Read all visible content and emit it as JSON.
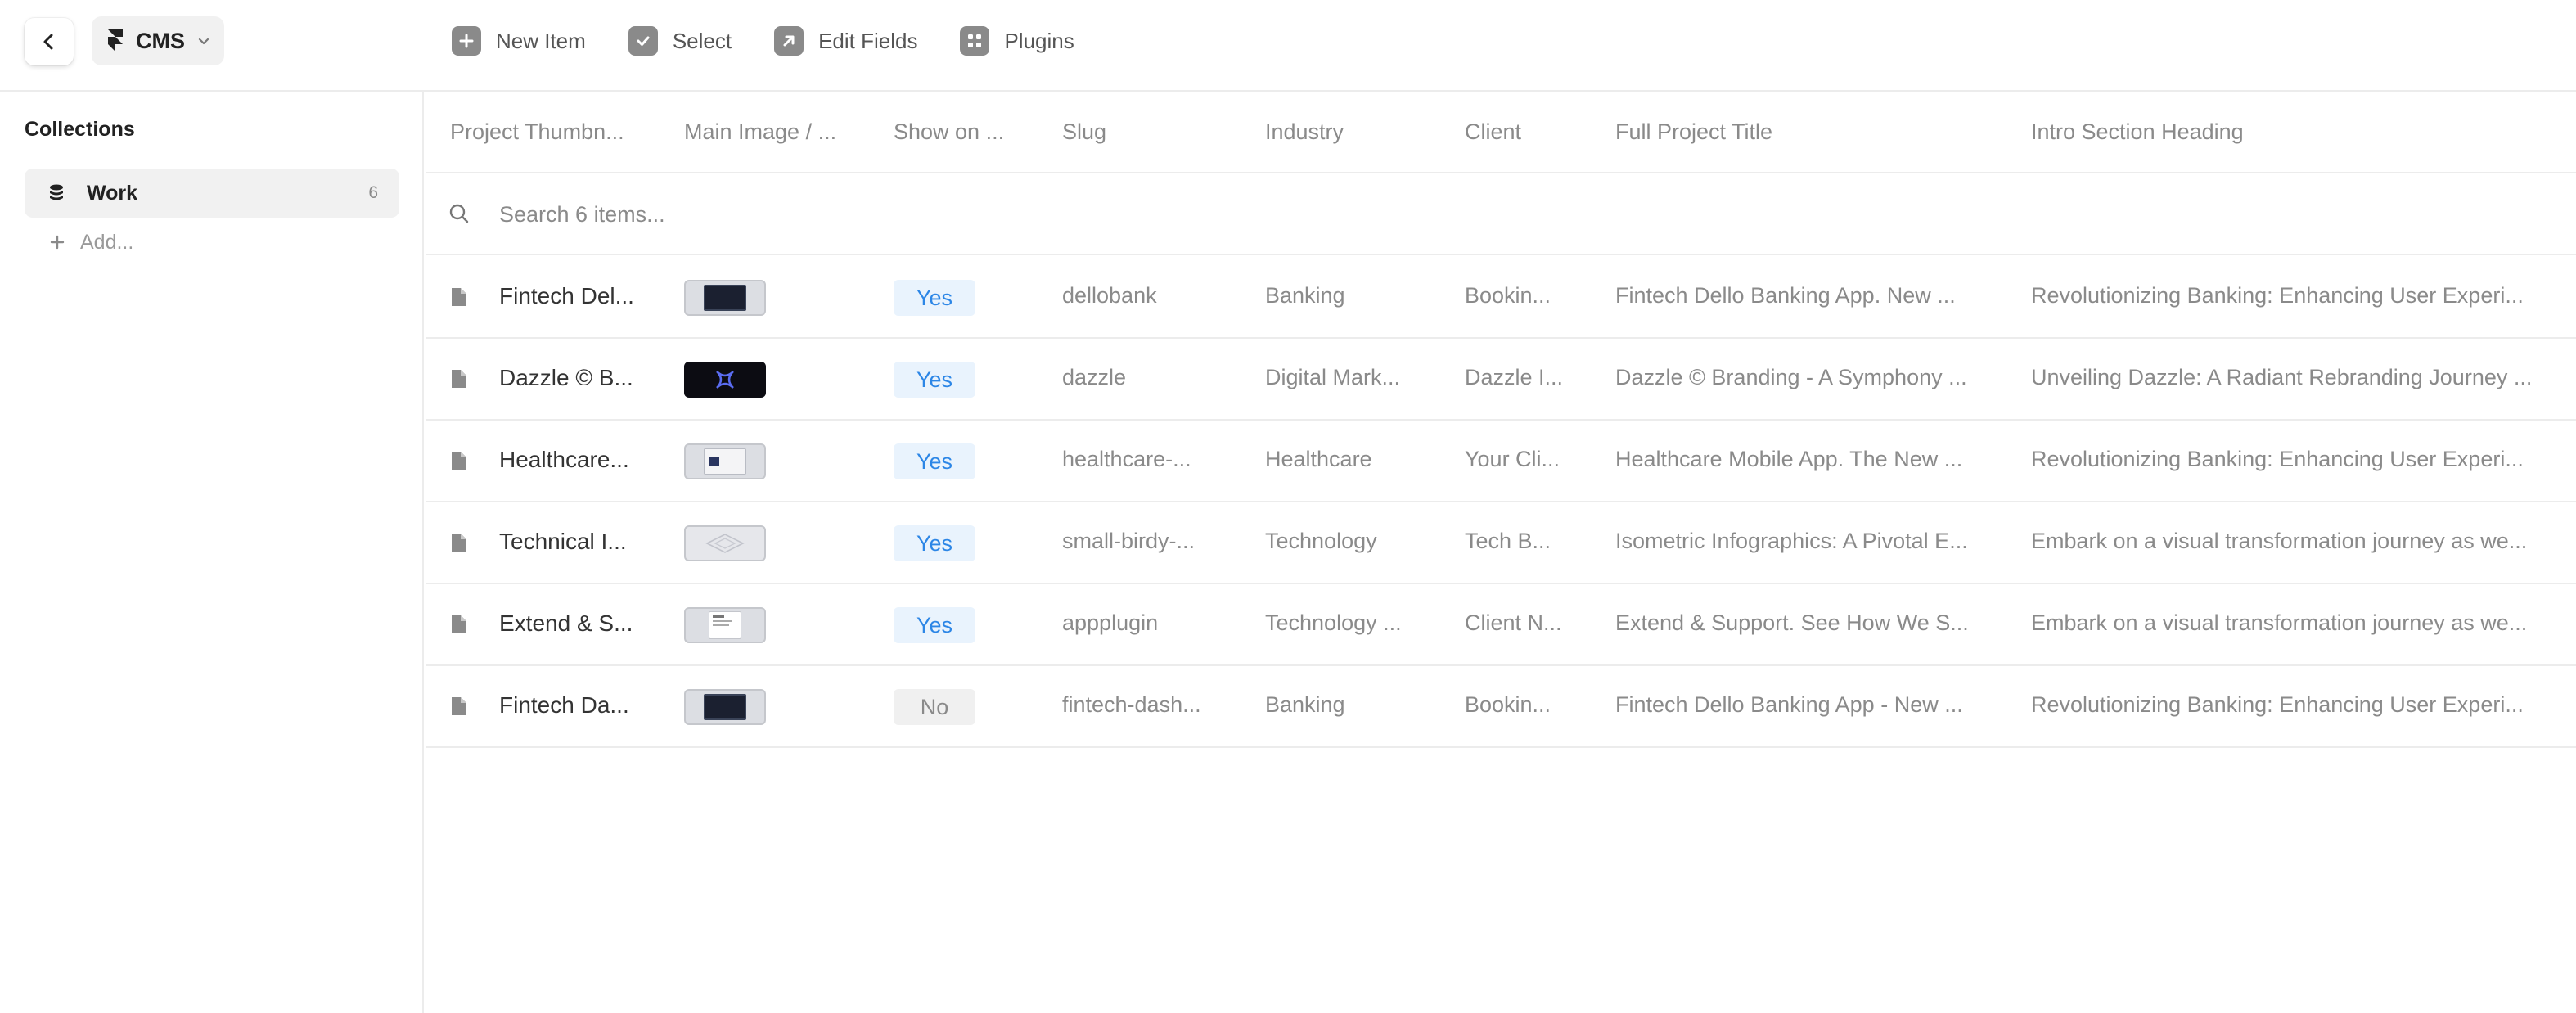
{
  "topbar": {
    "project_name": "CMS",
    "tools": [
      {
        "label": "New Item",
        "icon": "plus-icon"
      },
      {
        "label": "Select",
        "icon": "check-icon"
      },
      {
        "label": "Edit Fields",
        "icon": "arrow-up-right-icon"
      },
      {
        "label": "Plugins",
        "icon": "plugins-icon"
      }
    ]
  },
  "sidebar": {
    "heading": "Collections",
    "collections": [
      {
        "label": "Work",
        "count": "6",
        "icon": "database-icon"
      }
    ],
    "add_label": "Add..."
  },
  "table": {
    "columns": [
      "Project Thumbn...",
      "Main Image / ...",
      "Show on ...",
      "Slug",
      "Industry",
      "Client",
      "Full Project Title",
      "Intro Section Heading"
    ],
    "search_placeholder": "Search 6 items...",
    "rows": [
      {
        "title": "Fintech Del...",
        "thumb": "dark-screenshot",
        "show": "Yes",
        "slug": "dellobank",
        "industry": "Banking",
        "client": "Bookin...",
        "full_title": "Fintech Dello Banking App. New ...",
        "intro": "Revolutionizing Banking: Enhancing User Experi..."
      },
      {
        "title": "Dazzle © B...",
        "thumb": "dazzle-logo",
        "show": "Yes",
        "slug": "dazzle",
        "industry": "Digital Mark...",
        "client": "Dazzle I...",
        "full_title": "Dazzle © Branding - A Symphony ...",
        "intro": "Unveiling Dazzle: A Radiant Rebranding Journey ..."
      },
      {
        "title": "Healthcare...",
        "thumb": "light-screenshot",
        "show": "Yes",
        "slug": "healthcare-...",
        "industry": "Healthcare",
        "client": "Your Cli...",
        "full_title": "Healthcare Mobile App. The New ...",
        "intro": "Revolutionizing Banking: Enhancing User Experi..."
      },
      {
        "title": "Technical I...",
        "thumb": "isometric-drawing",
        "show": "Yes",
        "slug": "small-birdy-...",
        "industry": "Technology",
        "client": "Tech B...",
        "full_title": "Isometric Infographics: A Pivotal E...",
        "intro": "Embark on a visual transformation journey as we..."
      },
      {
        "title": "Extend & S...",
        "thumb": "white-document",
        "show": "Yes",
        "slug": "appplugin",
        "industry": "Technology ...",
        "client": "Client N...",
        "full_title": "Extend & Support. See How We S...",
        "intro": "Embark on a visual transformation journey as we..."
      },
      {
        "title": "Fintech Da...",
        "thumb": "dark-screenshot",
        "show": "No",
        "slug": "fintech-dash...",
        "industry": "Banking",
        "client": "Bookin...",
        "full_title": "Fintech Dello Banking App - New ...",
        "intro": "Revolutionizing Banking: Enhancing User Experi..."
      }
    ]
  },
  "colors": {
    "accent_blue": "#2c86e6",
    "yes_bg": "#e9f3fd",
    "no_bg": "#f0f0f0",
    "muted_text": "#8a8a8a",
    "divider": "#ececec"
  }
}
